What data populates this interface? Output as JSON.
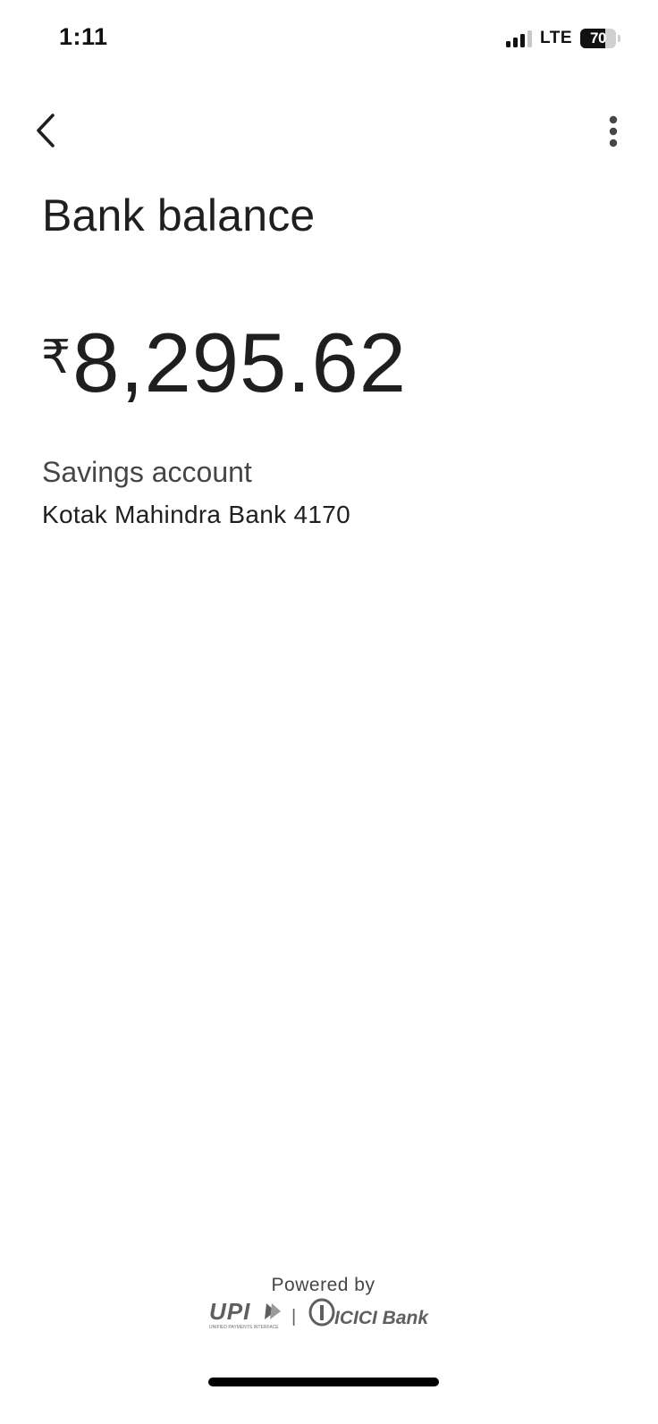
{
  "status_bar": {
    "time": "1:11",
    "network": "LTE",
    "battery_level": "70",
    "battery_fraction": 0.7,
    "signal_bars_active": 3,
    "signal_bars_total": 4
  },
  "app_bar": {
    "back_icon": "chevron-left-icon",
    "menu_icon": "more-vertical-icon"
  },
  "main": {
    "title": "Bank balance",
    "currency_symbol": "₹",
    "balance": "8,295.62",
    "account_type": "Savings account",
    "account_bank": "Kotak Mahindra Bank 4170"
  },
  "footer": {
    "powered_by": "Powered by",
    "upi_logo_text": "UPI",
    "upi_tagline": "UNIFIED PAYMENTS INTERFACE",
    "separator": "|",
    "bank_logo_text": "ICICI Bank"
  },
  "colors": {
    "text_primary": "#1f1f1f",
    "text_secondary": "#444746",
    "background": "#ffffff"
  }
}
